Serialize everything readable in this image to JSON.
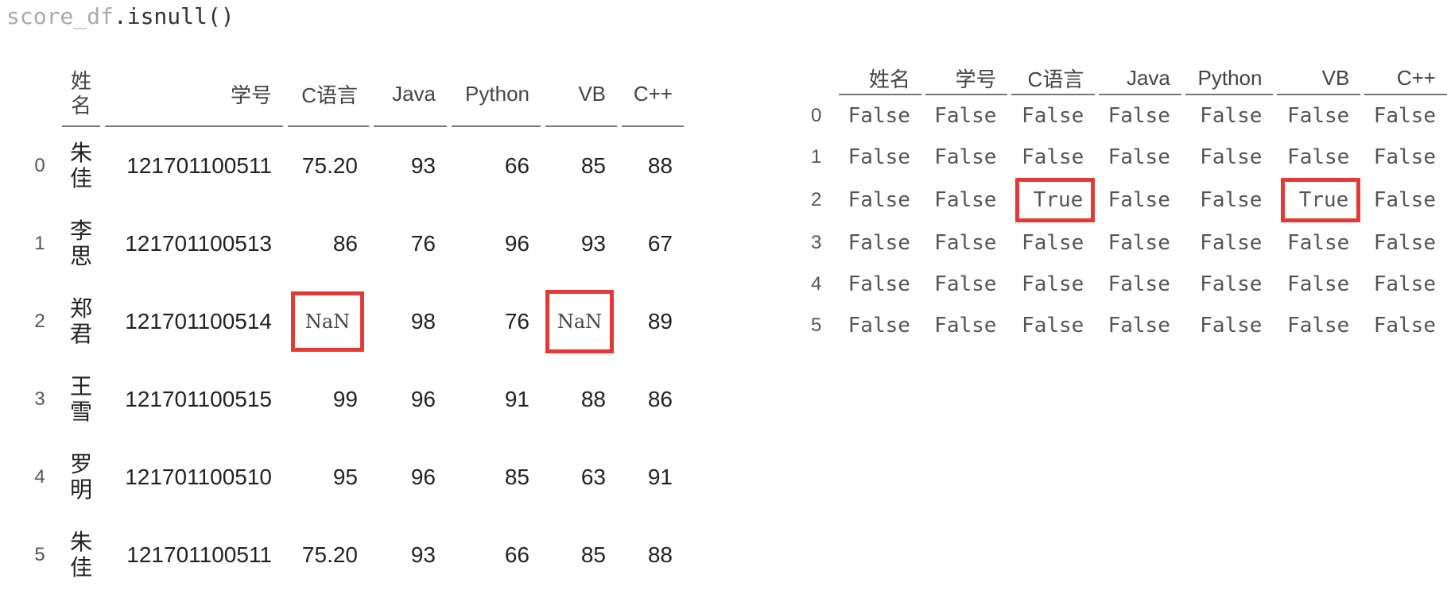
{
  "code": {
    "var": "score_df",
    "method": ".isnull()"
  },
  "left_table": {
    "columns": [
      "姓名",
      "学号",
      "C语言",
      "Java",
      "Python",
      "VB",
      "C++"
    ],
    "rows": [
      {
        "index": "0",
        "name": "朱佳",
        "sid": "121701100511",
        "c": "75.20",
        "java": "93",
        "python": "66",
        "vb": "85",
        "cpp": "88"
      },
      {
        "index": "1",
        "name": "李思",
        "sid": "121701100513",
        "c": "86",
        "java": "76",
        "python": "96",
        "vb": "93",
        "cpp": "67"
      },
      {
        "index": "2",
        "name": "郑君",
        "sid": "121701100514",
        "c": "NaN",
        "java": "98",
        "python": "76",
        "vb": "NaN",
        "cpp": "89"
      },
      {
        "index": "3",
        "name": "王雪",
        "sid": "121701100515",
        "c": "99",
        "java": "96",
        "python": "91",
        "vb": "88",
        "cpp": "86"
      },
      {
        "index": "4",
        "name": "罗明",
        "sid": "121701100510",
        "c": "95",
        "java": "96",
        "python": "85",
        "vb": "63",
        "cpp": "91"
      },
      {
        "index": "5",
        "name": "朱佳",
        "sid": "121701100511",
        "c": "75.20",
        "java": "93",
        "python": "66",
        "vb": "85",
        "cpp": "88"
      }
    ]
  },
  "right_table": {
    "columns": [
      "姓名",
      "学号",
      "C语言",
      "Java",
      "Python",
      "VB",
      "C++"
    ],
    "rows": [
      {
        "index": "0",
        "values": [
          "False",
          "False",
          "False",
          "False",
          "False",
          "False",
          "False"
        ]
      },
      {
        "index": "1",
        "values": [
          "False",
          "False",
          "False",
          "False",
          "False",
          "False",
          "False"
        ]
      },
      {
        "index": "2",
        "values": [
          "False",
          "False",
          "True",
          "False",
          "False",
          "True",
          "False"
        ]
      },
      {
        "index": "3",
        "values": [
          "False",
          "False",
          "False",
          "False",
          "False",
          "False",
          "False"
        ]
      },
      {
        "index": "4",
        "values": [
          "False",
          "False",
          "False",
          "False",
          "False",
          "False",
          "False"
        ]
      },
      {
        "index": "5",
        "values": [
          "False",
          "False",
          "False",
          "False",
          "False",
          "False",
          "False"
        ]
      }
    ]
  },
  "highlight_color": "#e53935"
}
